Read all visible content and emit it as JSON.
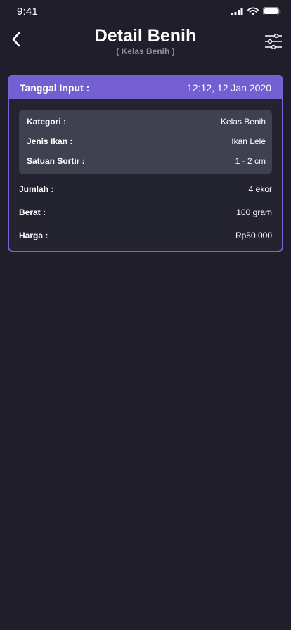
{
  "status_bar": {
    "time": "9:41"
  },
  "header": {
    "title": "Detail Benih",
    "subtitle": "( Kelas Benih )"
  },
  "card": {
    "date_label": "Tanggal Input :",
    "date_value": "12:12, 12 Jan 2020",
    "details": [
      {
        "label": "Kategori :",
        "value": "Kelas Benih"
      },
      {
        "label": "Jenis Ikan :",
        "value": "Ikan Lele"
      },
      {
        "label": "Satuan Sortir :",
        "value": "1 - 2 cm"
      }
    ],
    "summary": [
      {
        "label": "Jumlah :",
        "value": "4 ekor"
      },
      {
        "label": "Berat :",
        "value": "100 gram"
      },
      {
        "label": "Harga :",
        "value": "Rp50.000"
      }
    ]
  },
  "colors": {
    "background": "#1f1e2a",
    "accent": "#735fcf",
    "card_border": "#7a63d8",
    "inner_box": "#3f4150"
  },
  "icons": [
    "signal-icon",
    "wifi-icon",
    "battery-icon",
    "back-arrow-icon",
    "filter-sliders-icon"
  ]
}
